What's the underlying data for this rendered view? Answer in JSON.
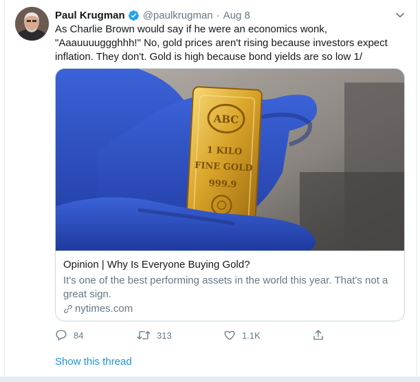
{
  "tweet": {
    "author_name": "Paul Krugman",
    "handle": "@paulkrugman",
    "separator": "·",
    "date": "Aug 8",
    "text_lines": [
      "As Charlie Brown would say if he were an economics wonk,",
      "\"Aaauuuuggghhh!\" No, gold prices aren't rising because investors expect",
      "inflation. They don't. Gold is high because bond yields are so low 1/"
    ],
    "verified": true
  },
  "card": {
    "title": "Opinion | Why Is Everyone Buying Gold?",
    "description_lines": [
      "It's one of the best performing assets in the world this year. That's not a",
      "great sign."
    ],
    "domain": "nytimes.com",
    "image_text": {
      "logo": "ABC",
      "line1": "1 KILO",
      "line2": "FINE GOLD",
      "line3": "999.9"
    }
  },
  "actions": {
    "reply_count": "84",
    "retweet_count": "313",
    "like_count": "1.1K"
  },
  "thread": {
    "show_label": "Show this thread"
  },
  "colors": {
    "accent": "#1b95e0",
    "verified": "#1da1f2",
    "secondary_text": "#657786",
    "gold": "#c8961e",
    "glove": "#2f4fc4"
  },
  "icons": {
    "verified": "verified-badge-icon",
    "more": "chevron-down-icon",
    "link": "link-icon",
    "reply": "reply-icon",
    "retweet": "retweet-icon",
    "like": "heart-icon",
    "share": "share-icon"
  }
}
